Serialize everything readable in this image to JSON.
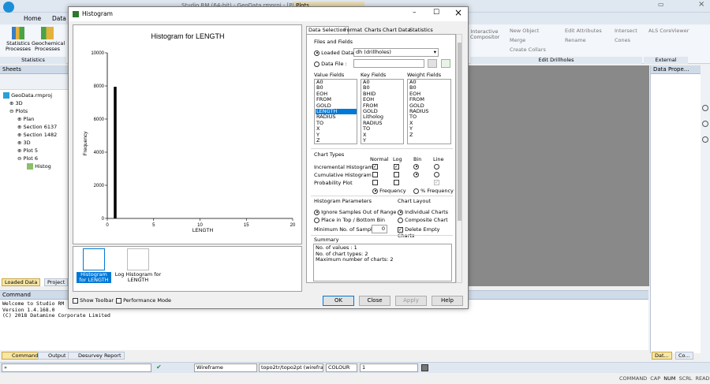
{
  "app": {
    "window_title": "Studio RM (64-bit) - GeoData.rmproj - [Plots]",
    "ribbon_tabs": [
      "Home",
      "Data"
    ],
    "context_tab": "Plots",
    "stats_group": {
      "button1": "Statistics Processes",
      "button2": "Geochemical Processes",
      "label": "Statistics"
    },
    "drillhole_group": {
      "items": [
        "Interactive Compositor",
        "New Object",
        "Merge",
        "Create Collars",
        "Edit Attributes",
        "Rename",
        "Intersect",
        "Cones"
      ],
      "label": "Edit Drillholes"
    },
    "external_group": {
      "item": "ALS CoreViewer",
      "label": "External"
    }
  },
  "sheets": {
    "title": "Sheets",
    "tree": [
      "GeoData.rmproj",
      "3D",
      "Plots",
      "Plan",
      "Section 6137",
      "Section 1482",
      "3D",
      "Plot 5",
      "Plot 6",
      "Histog"
    ],
    "bottom_tabs": [
      "Loaded Data",
      "Project"
    ]
  },
  "data_properties": {
    "title": "Data Prope...",
    "bottom_tabs": [
      "Dat...",
      "Co..."
    ]
  },
  "command": {
    "title": "Command",
    "lines": [
      "Welcome to Studio RM",
      "Version 1.4.168.0",
      "(C) 2018 Datamine Corporate Limited"
    ],
    "bottom_tabs": [
      "Command",
      "Output",
      "Desurvey Report"
    ]
  },
  "toolbar": {
    "wireframe": "Wireframe",
    "topo": "topo2tr/topo2pt (wirefra",
    "colour": "COLOUR",
    "value": "1"
  },
  "status": {
    "items": [
      "COMMAND",
      "CAP",
      "NUM",
      "SCRL",
      "READ"
    ]
  },
  "dialog": {
    "title": "Histogram",
    "tabs": [
      "Data Selection",
      "Format",
      "Charts",
      "Chart Data",
      "Statistics"
    ],
    "files_fields": {
      "label": "Files and Fields",
      "loaded_data_label": "Loaded Data :",
      "loaded_data_value": "dh (drillholes)",
      "data_file_label": "Data File :"
    },
    "value_fields": {
      "label": "Value Fields",
      "items": [
        "A0",
        "B0",
        "EOH",
        "FROM",
        "GOLD",
        "LENGTH",
        "RADIUS",
        "TO",
        "X",
        "Y",
        "Z"
      ],
      "selected": "LENGTH"
    },
    "key_fields": {
      "label": "Key Fields",
      "items": [
        "A0",
        "B0",
        "BHID",
        "EOH",
        "FROM",
        "GOLD",
        "Litholog",
        "RADIUS",
        "TO",
        "X",
        "Y"
      ]
    },
    "weight_fields": {
      "label": "Weight Fields",
      "items": [
        "A0",
        "B0",
        "EOH",
        "FROM",
        "GOLD",
        "RADIUS",
        "TO",
        "X",
        "Y",
        "Z"
      ]
    },
    "chart_types": {
      "label": "Chart Types",
      "columns": [
        "Normal",
        "Log",
        "Bin",
        "Line"
      ],
      "rows": [
        "Incremental Histogram",
        "Cumulative Histogram",
        "Probability Plot"
      ],
      "frequency": "Frequency",
      "pct_frequency": "% Frequency"
    },
    "histogram_params": {
      "label": "Histogram Parameters",
      "ignore": "Ignore Samples Out of Range",
      "place": "Place in Top / Bottom Bin",
      "min_samples_label": "Minimum No. of Samples",
      "min_samples_value": "0"
    },
    "chart_layout": {
      "label": "Chart Layout",
      "individual": "Individual Charts",
      "composite": "Composite Chart",
      "delete_empty": "Delete Empty Charts"
    },
    "summary": {
      "label": "Summary",
      "lines": [
        "No. of values : 1",
        "No. of chart types: 2",
        "Maximum number of charts: 2"
      ]
    },
    "thumbs": [
      "Histogram for LENGTH",
      "Log Histogram for LENGTH"
    ],
    "show_toolbar": "Show Toolbar",
    "performance_mode": "Performance Mode",
    "buttons": {
      "ok": "OK",
      "close": "Close",
      "apply": "Apply",
      "help": "Help"
    }
  },
  "chart_data": {
    "type": "bar",
    "title": "Histogram for LENGTH",
    "xlabel": "LENGTH",
    "ylabel": "Frequency",
    "xlim": [
      0,
      20
    ],
    "ylim": [
      0,
      10000
    ],
    "xticks": [
      0,
      5,
      10,
      15,
      20
    ],
    "yticks": [
      0,
      2000,
      4000,
      6000,
      8000,
      10000
    ],
    "bins": [
      {
        "x0": 0.7,
        "x1": 1.0,
        "value": 7950
      }
    ]
  },
  "colors": {
    "accent": "#0078d7",
    "workspace": "#898989",
    "ribbon": "#dfe7f1"
  }
}
